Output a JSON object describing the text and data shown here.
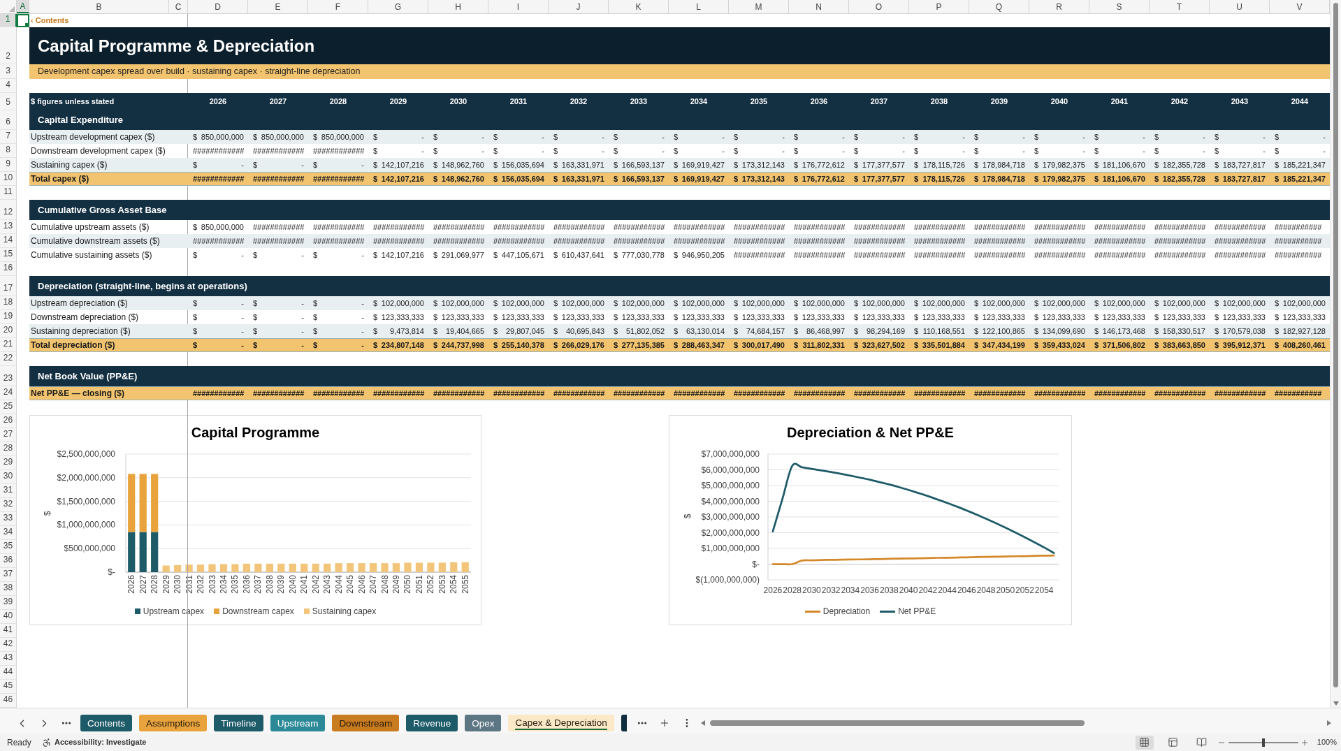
{
  "columns": [
    {
      "label": "A",
      "selected": true
    },
    {
      "label": "B",
      "selected": false
    },
    {
      "label": "C",
      "selected": false
    },
    {
      "label": "D",
      "selected": false
    },
    {
      "label": "E",
      "selected": false
    },
    {
      "label": "F",
      "selected": false
    },
    {
      "label": "G",
      "selected": false
    },
    {
      "label": "H",
      "selected": false
    },
    {
      "label": "I",
      "selected": false
    },
    {
      "label": "J",
      "selected": false
    },
    {
      "label": "K",
      "selected": false
    },
    {
      "label": "L",
      "selected": false
    },
    {
      "label": "M",
      "selected": false
    },
    {
      "label": "N",
      "selected": false
    },
    {
      "label": "O",
      "selected": false
    },
    {
      "label": "P",
      "selected": false
    },
    {
      "label": "Q",
      "selected": false
    },
    {
      "label": "R",
      "selected": false
    },
    {
      "label": "S",
      "selected": false
    },
    {
      "label": "T",
      "selected": false
    },
    {
      "label": "U",
      "selected": false
    },
    {
      "label": "V",
      "selected": false
    }
  ],
  "row_headers": [
    {
      "label": "1",
      "selected": true
    },
    {
      "label": "2",
      "selected": false
    },
    {
      "label": "3",
      "selected": false
    },
    {
      "label": "4",
      "selected": false
    },
    {
      "label": "5",
      "selected": false
    },
    {
      "label": "6",
      "selected": false
    },
    {
      "label": "7",
      "selected": false
    },
    {
      "label": "8",
      "selected": false
    },
    {
      "label": "9",
      "selected": false
    },
    {
      "label": "10",
      "selected": false
    },
    {
      "label": "11",
      "selected": false
    },
    {
      "label": "12",
      "selected": false
    },
    {
      "label": "13",
      "selected": false
    },
    {
      "label": "14",
      "selected": false
    },
    {
      "label": "15",
      "selected": false
    },
    {
      "label": "16",
      "selected": false
    },
    {
      "label": "17",
      "selected": false
    },
    {
      "label": "18",
      "selected": false
    },
    {
      "label": "19",
      "selected": false
    },
    {
      "label": "20",
      "selected": false
    },
    {
      "label": "21",
      "selected": false
    },
    {
      "label": "22",
      "selected": false
    },
    {
      "label": "23",
      "selected": false
    },
    {
      "label": "24",
      "selected": false
    },
    {
      "label": "25",
      "selected": false
    },
    {
      "label": "26",
      "selected": false
    },
    {
      "label": "27",
      "selected": false
    },
    {
      "label": "28",
      "selected": false
    },
    {
      "label": "29",
      "selected": false
    },
    {
      "label": "30",
      "selected": false
    },
    {
      "label": "31",
      "selected": false
    },
    {
      "label": "32",
      "selected": false
    },
    {
      "label": "33",
      "selected": false
    },
    {
      "label": "34",
      "selected": false
    },
    {
      "label": "35",
      "selected": false
    },
    {
      "label": "36",
      "selected": false
    },
    {
      "label": "37",
      "selected": false
    },
    {
      "label": "38",
      "selected": false
    },
    {
      "label": "39",
      "selected": false
    },
    {
      "label": "40",
      "selected": false
    },
    {
      "label": "41",
      "selected": false
    },
    {
      "label": "42",
      "selected": false
    },
    {
      "label": "43",
      "selected": false
    },
    {
      "label": "44",
      "selected": false
    },
    {
      "label": "45",
      "selected": false
    },
    {
      "label": "46",
      "selected": false
    }
  ],
  "sheet": {
    "link": "‹ Contents",
    "title": "Capital Programme & Depreciation",
    "subtitle": "Development capex spread over build · sustaining capex · straight-line depreciation"
  },
  "table": {
    "units_label": "$ figures unless stated",
    "years": [
      "2026",
      "2027",
      "2028",
      "2029",
      "2030",
      "2031",
      "2032",
      "2033",
      "2034",
      "2035",
      "2036",
      "2037",
      "2038",
      "2039",
      "2040",
      "2041",
      "2042",
      "2043",
      "2044"
    ],
    "sections": [
      {
        "title": "Capital Expenditure",
        "rows": [
          {
            "label": "Upstream development capex ($)",
            "kind": "shaded",
            "cells": [
              "$ 850,000,000",
              "$ 850,000,000",
              "$ 850,000,000",
              "$ -",
              "$ -",
              "$ -",
              "$ -",
              "$ -",
              "$ -",
              "$ -",
              "$ -",
              "$ -",
              "$ -",
              "$ -",
              "$ -",
              "$ -",
              "$ -",
              "$ -",
              "$ -"
            ]
          },
          {
            "label": "Downstream development capex ($)",
            "kind": "plain",
            "cells": [
              "############",
              "############",
              "############",
              "$ -",
              "$ -",
              "$ -",
              "$ -",
              "$ -",
              "$ -",
              "$ -",
              "$ -",
              "$ -",
              "$ -",
              "$ -",
              "$ -",
              "$ -",
              "$ -",
              "$ -",
              "$ -"
            ]
          },
          {
            "label": "Sustaining capex ($)",
            "kind": "shaded",
            "cells": [
              "$ -",
              "$ -",
              "$ -",
              "$ 142,107,216",
              "$ 148,962,760",
              "$ 156,035,694",
              "$ 163,331,971",
              "$ 166,593,137",
              "$ 169,919,427",
              "$ 173,312,143",
              "$ 176,772,612",
              "$ 177,377,577",
              "$ 178,115,726",
              "$ 178,984,718",
              "$ 179,982,375",
              "$ 181,106,670",
              "$ 182,355,728",
              "$ 183,727,817",
              "$ 185,221,347"
            ]
          },
          {
            "label": "Total capex ($)",
            "kind": "total",
            "cells": [
              "############",
              "############",
              "############",
              "$ 142,107,216",
              "$ 148,962,760",
              "$ 156,035,694",
              "$ 163,331,971",
              "$ 166,593,137",
              "$ 169,919,427",
              "$ 173,312,143",
              "$ 176,772,612",
              "$ 177,377,577",
              "$ 178,115,726",
              "$ 178,984,718",
              "$ 179,982,375",
              "$ 181,106,670",
              "$ 182,355,728",
              "$ 183,727,817",
              "$ 185,221,347"
            ]
          }
        ]
      },
      {
        "title": "Cumulative Gross Asset Base",
        "rows": [
          {
            "label": "Cumulative upstream assets ($)",
            "kind": "plain",
            "cells": [
              "$ 850,000,000",
              "############",
              "############",
              "############",
              "############",
              "############",
              "############",
              "############",
              "############",
              "############",
              "############",
              "############",
              "############",
              "############",
              "############",
              "############",
              "############",
              "############",
              "###########"
            ]
          },
          {
            "label": "Cumulative downstream assets ($)",
            "kind": "shaded",
            "cells": [
              "############",
              "############",
              "############",
              "############",
              "############",
              "############",
              "############",
              "############",
              "############",
              "############",
              "############",
              "############",
              "############",
              "############",
              "############",
              "############",
              "############",
              "############",
              "###########"
            ]
          },
          {
            "label": "Cumulative sustaining assets ($)",
            "kind": "plain",
            "cells": [
              "$ -",
              "$ -",
              "$ -",
              "$ 142,107,216",
              "$ 291,069,977",
              "$ 447,105,671",
              "$ 610,437,641",
              "$ 777,030,778",
              "$ 946,950,205",
              "############",
              "############",
              "############",
              "############",
              "############",
              "############",
              "############",
              "############",
              "############",
              "###########"
            ]
          }
        ]
      },
      {
        "title": "Depreciation (straight-line, begins at operations)",
        "rows": [
          {
            "label": "Upstream depreciation ($)",
            "kind": "shaded",
            "cells": [
              "$ -",
              "$ -",
              "$ -",
              "$ 102,000,000",
              "$ 102,000,000",
              "$ 102,000,000",
              "$ 102,000,000",
              "$ 102,000,000",
              "$ 102,000,000",
              "$ 102,000,000",
              "$ 102,000,000",
              "$ 102,000,000",
              "$ 102,000,000",
              "$ 102,000,000",
              "$ 102,000,000",
              "$ 102,000,000",
              "$ 102,000,000",
              "$ 102,000,000",
              "$ 102,000,000"
            ]
          },
          {
            "label": "Downstream depreciation ($)",
            "kind": "plain",
            "cells": [
              "$ -",
              "$ -",
              "$ -",
              "$ 123,333,333",
              "$ 123,333,333",
              "$ 123,333,333",
              "$ 123,333,333",
              "$ 123,333,333",
              "$ 123,333,333",
              "$ 123,333,333",
              "$ 123,333,333",
              "$ 123,333,333",
              "$ 123,333,333",
              "$ 123,333,333",
              "$ 123,333,333",
              "$ 123,333,333",
              "$ 123,333,333",
              "$ 123,333,333",
              "$ 123,333,333"
            ]
          },
          {
            "label": "Sustaining depreciation ($)",
            "kind": "shaded",
            "cells": [
              "$ -",
              "$ -",
              "$ -",
              "$ 9,473,814",
              "$ 19,404,665",
              "$ 29,807,045",
              "$ 40,695,843",
              "$ 51,802,052",
              "$ 63,130,014",
              "$ 74,684,157",
              "$ 86,468,997",
              "$ 98,294,169",
              "$ 110,168,551",
              "$ 122,100,865",
              "$ 134,099,690",
              "$ 146,173,468",
              "$ 158,330,517",
              "$ 170,579,038",
              "$ 182,927,128"
            ]
          },
          {
            "label": "Total depreciation ($)",
            "kind": "total",
            "cells": [
              "$ -",
              "$ -",
              "$ -",
              "$ 234,807,148",
              "$ 244,737,998",
              "$ 255,140,378",
              "$ 266,029,176",
              "$ 277,135,385",
              "$ 288,463,347",
              "$ 300,017,490",
              "$ 311,802,331",
              "$ 323,627,502",
              "$ 335,501,884",
              "$ 347,434,199",
              "$ 359,433,024",
              "$ 371,506,802",
              "$ 383,663,850",
              "$ 395,912,371",
              "$ 408,260,461"
            ]
          }
        ]
      },
      {
        "title": "Net Book Value (PP&E)",
        "rows": [
          {
            "label": "Net PP&E — closing ($)",
            "kind": "total",
            "cells": [
              "############",
              "############",
              "############",
              "############",
              "############",
              "############",
              "############",
              "############",
              "############",
              "############",
              "############",
              "############",
              "############",
              "############",
              "############",
              "############",
              "############",
              "############",
              "###########"
            ]
          }
        ]
      }
    ]
  },
  "charts": [
    {
      "chart_data": {
        "type": "bar",
        "title": "Capital Programme",
        "ylabel": "$",
        "stacked": true,
        "grid": true,
        "legend": "bottom",
        "categories": [
          "2026",
          "2027",
          "2028",
          "2029",
          "2030",
          "2031",
          "2032",
          "2033",
          "2034",
          "2035",
          "2036",
          "2037",
          "2038",
          "2039",
          "2040",
          "2041",
          "2042",
          "2043",
          "2044",
          "2045",
          "2046",
          "2047",
          "2048",
          "2049",
          "2050",
          "2051",
          "2052",
          "2053",
          "2054",
          "2055"
        ],
        "series": [
          {
            "name": "Upstream capex",
            "color": "#1e5b69",
            "values": [
              850000000,
              850000000,
              850000000,
              0,
              0,
              0,
              0,
              0,
              0,
              0,
              0,
              0,
              0,
              0,
              0,
              0,
              0,
              0,
              0,
              0,
              0,
              0,
              0,
              0,
              0,
              0,
              0,
              0,
              0,
              0
            ]
          },
          {
            "name": "Downstream capex",
            "color": "#e8a33d",
            "values": [
              1230000000,
              1230000000,
              1230000000,
              0,
              0,
              0,
              0,
              0,
              0,
              0,
              0,
              0,
              0,
              0,
              0,
              0,
              0,
              0,
              0,
              0,
              0,
              0,
              0,
              0,
              0,
              0,
              0,
              0,
              0,
              0
            ]
          },
          {
            "name": "Sustaining capex",
            "color": "#f2c57a",
            "values": [
              0,
              0,
              0,
              140000000,
              150000000,
              160000000,
              160000000,
              170000000,
              170000000,
              170000000,
              180000000,
              180000000,
              180000000,
              180000000,
              180000000,
              180000000,
              180000000,
              180000000,
              190000000,
              190000000,
              190000000,
              190000000,
              190000000,
              190000000,
              200000000,
              200000000,
              200000000,
              200000000,
              210000000,
              210000000
            ]
          }
        ],
        "ylim": [
          0,
          2500000000
        ],
        "yticks": [
          {
            "value": 0,
            "label": "$-"
          },
          {
            "value": 500000000,
            "label": "$500,000,000"
          },
          {
            "value": 1000000000,
            "label": "$1,000,000,000"
          },
          {
            "value": 1500000000,
            "label": "$1,500,000,000"
          },
          {
            "value": 2000000000,
            "label": "$2,000,000,000"
          },
          {
            "value": 2500000000,
            "label": "$2,500,000,000"
          }
        ]
      }
    },
    {
      "chart_data": {
        "type": "line",
        "title": "Depreciation & Net PP&E",
        "ylabel": "$",
        "grid": true,
        "legend": "bottom",
        "x": [
          2026,
          2027,
          2028,
          2029,
          2030,
          2031,
          2032,
          2033,
          2034,
          2035,
          2036,
          2037,
          2038,
          2039,
          2040,
          2041,
          2042,
          2043,
          2044,
          2045,
          2046,
          2047,
          2048,
          2049,
          2050,
          2051,
          2052,
          2053,
          2054,
          2055
        ],
        "xlim": [
          2025.5,
          2055.5
        ],
        "xticks": [
          {
            "value": 2026,
            "label": "2026"
          },
          {
            "value": 2028,
            "label": "2028"
          },
          {
            "value": 2030,
            "label": "2030"
          },
          {
            "value": 2032,
            "label": "2032"
          },
          {
            "value": 2034,
            "label": "2034"
          },
          {
            "value": 2036,
            "label": "2036"
          },
          {
            "value": 2038,
            "label": "2038"
          },
          {
            "value": 2040,
            "label": "2040"
          },
          {
            "value": 2042,
            "label": "2042"
          },
          {
            "value": 2044,
            "label": "2044"
          },
          {
            "value": 2046,
            "label": "2046"
          },
          {
            "value": 2048,
            "label": "2048"
          },
          {
            "value": 2050,
            "label": "2050"
          },
          {
            "value": 2052,
            "label": "2052"
          },
          {
            "value": 2054,
            "label": "2054"
          }
        ],
        "series": [
          {
            "name": "Depreciation",
            "color": "#d4882a",
            "values": [
              0,
              0,
              0,
              230000000,
              240000000,
              260000000,
              270000000,
              280000000,
              290000000,
              300000000,
              310000000,
              320000000,
              340000000,
              350000000,
              360000000,
              370000000,
              380000000,
              400000000,
              410000000,
              420000000,
              430000000,
              450000000,
              460000000,
              470000000,
              480000000,
              500000000,
              510000000,
              530000000,
              540000000,
              550000000
            ]
          },
          {
            "name": "Net PP&E",
            "color": "#1e5b69",
            "values": [
              2080000000,
              4170000000,
              6250000000,
              6160000000,
              6060000000,
              5960000000,
              5860000000,
              5750000000,
              5630000000,
              5500000000,
              5370000000,
              5220000000,
              5070000000,
              4900000000,
              4720000000,
              4530000000,
              4330000000,
              4110000000,
              3890000000,
              3660000000,
              3410000000,
              3160000000,
              2890000000,
              2610000000,
              2320000000,
              2020000000,
              1710000000,
              1390000000,
              1060000000,
              710000000
            ]
          }
        ],
        "ylim": [
          -1000000000,
          7000000000
        ],
        "yticks": [
          {
            "value": -1000000000,
            "label": "$(1,000,000,000)"
          },
          {
            "value": 0,
            "label": "$-"
          },
          {
            "value": 1000000000,
            "label": "$1,000,000,000"
          },
          {
            "value": 2000000000,
            "label": "$2,000,000,000"
          },
          {
            "value": 3000000000,
            "label": "$3,000,000,000"
          },
          {
            "value": 4000000000,
            "label": "$4,000,000,000"
          },
          {
            "value": 5000000000,
            "label": "$5,000,000,000"
          },
          {
            "value": 6000000000,
            "label": "$6,000,000,000"
          },
          {
            "value": 7000000000,
            "label": "$7,000,000,000"
          }
        ]
      }
    }
  ],
  "sheet_tabs": {
    "items": [
      {
        "label": "Contents",
        "color": "#1e5b69",
        "selected": false
      },
      {
        "label": "Assumptions",
        "color": "#e8a33d",
        "selected": false
      },
      {
        "label": "Timeline",
        "color": "#1e5b69",
        "selected": false
      },
      {
        "label": "Upstream",
        "color": "#2c8a98",
        "selected": false
      },
      {
        "label": "Downstream",
        "color": "#c97b1f",
        "selected": false
      },
      {
        "label": "Revenue",
        "color": "#1e5b69",
        "selected": false
      },
      {
        "label": "Opex",
        "color": "#5c7684",
        "selected": false
      },
      {
        "label": "Capex & Depreciation",
        "color": "#fbe8c6",
        "selected": true
      }
    ],
    "clipped_tab": {
      "color": "#0f2d3d"
    }
  },
  "status_bar": {
    "status": "Ready",
    "accessibility": "Accessibility: Investigate",
    "views": [
      {
        "kind": "normal",
        "selected": true
      },
      {
        "kind": "page_layout",
        "selected": false
      },
      {
        "kind": "page_break",
        "selected": false
      }
    ],
    "zoom": {
      "level": 0.5,
      "reading": "100%"
    }
  }
}
